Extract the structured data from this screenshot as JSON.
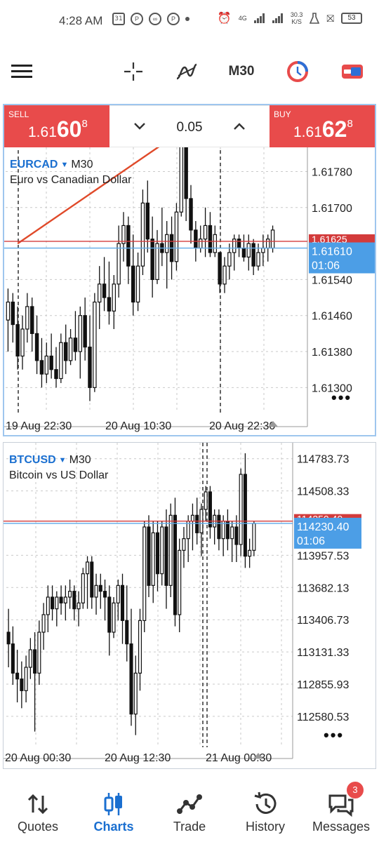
{
  "status_bar": {
    "time": "4:28 AM",
    "calendar": "31",
    "net_speed": "30.3",
    "net_unit": "K/S",
    "net_type": "4G",
    "battery": "53"
  },
  "toolbar": {
    "timeframe": "M30",
    "icons": [
      "menu-icon",
      "crosshair-icon",
      "indicators-icon",
      "timeframe",
      "one-click-trading-icon",
      "toggle-icon"
    ]
  },
  "trade_bar": {
    "sell_label": "SELL",
    "sell_price_prefix": "1.61",
    "sell_price_big": "60",
    "sell_price_sup": "8",
    "buy_label": "BUY",
    "buy_price_prefix": "1.61",
    "buy_price_big": "62",
    "buy_price_sup": "8",
    "lot": "0.05",
    "colors": {
      "trade_button": "#e84b4b"
    }
  },
  "eurcad_chart": {
    "symbol": "EURCAD",
    "timeframe": "M30",
    "description": "Euro vs Canadian Dollar",
    "more": "•••"
  },
  "btcusd_chart": {
    "symbol": "BTCUSD",
    "timeframe": "M30",
    "description": "Bitcoin vs US Dollar",
    "more": "•••"
  },
  "chart_data": [
    {
      "type": "candlestick",
      "symbol": "EURCAD",
      "timeframe": "M30",
      "y_ticks": [
        1.6178,
        1.617,
        1.6154,
        1.6146,
        1.6138,
        1.613
      ],
      "y_tick_labels": [
        "1.61780",
        "1.61700",
        "1.61540",
        "1.61460",
        "1.61380",
        "1.61300"
      ],
      "ylim": [
        1.6126,
        1.6184
      ],
      "x_tick_labels": [
        "19 Aug 22:30",
        "20 Aug 10:30",
        "20 Aug 22:30"
      ],
      "ask_price": 1.61625,
      "ask_label": "1.61625",
      "bid_price": 1.6161,
      "bid_label": "1.61610",
      "countdown": "01:06",
      "trendline": {
        "from": [
          2,
          1.6162
        ],
        "to": [
          32,
          1.6184
        ]
      },
      "colors": {
        "ask_line": "#d33b3b",
        "bid_line": "#5ea9e8",
        "trendline": "#e04a2a",
        "bid_tag": "#4c9ee6"
      },
      "candles": [
        {
          "o": 1.6145,
          "h": 1.6152,
          "l": 1.6138,
          "c": 1.6149
        },
        {
          "o": 1.6149,
          "h": 1.6151,
          "l": 1.614,
          "c": 1.6144
        },
        {
          "o": 1.6144,
          "h": 1.6148,
          "l": 1.6134,
          "c": 1.6137
        },
        {
          "o": 1.6137,
          "h": 1.6146,
          "l": 1.6134,
          "c": 1.6143
        },
        {
          "o": 1.6143,
          "h": 1.6151,
          "l": 1.614,
          "c": 1.6148
        },
        {
          "o": 1.6148,
          "h": 1.615,
          "l": 1.6138,
          "c": 1.6142
        },
        {
          "o": 1.6142,
          "h": 1.6146,
          "l": 1.6133,
          "c": 1.6136
        },
        {
          "o": 1.6136,
          "h": 1.6141,
          "l": 1.613,
          "c": 1.6133
        },
        {
          "o": 1.6133,
          "h": 1.614,
          "l": 1.6131,
          "c": 1.6137
        },
        {
          "o": 1.6137,
          "h": 1.6142,
          "l": 1.6132,
          "c": 1.6134
        },
        {
          "o": 1.6134,
          "h": 1.6139,
          "l": 1.613,
          "c": 1.6132
        },
        {
          "o": 1.6132,
          "h": 1.6142,
          "l": 1.6131,
          "c": 1.614
        },
        {
          "o": 1.614,
          "h": 1.6144,
          "l": 1.6133,
          "c": 1.6136
        },
        {
          "o": 1.6136,
          "h": 1.6143,
          "l": 1.6135,
          "c": 1.6141
        },
        {
          "o": 1.6141,
          "h": 1.6147,
          "l": 1.6136,
          "c": 1.6138
        },
        {
          "o": 1.6138,
          "h": 1.6148,
          "l": 1.6132,
          "c": 1.6146
        },
        {
          "o": 1.6146,
          "h": 1.615,
          "l": 1.6136,
          "c": 1.6139
        },
        {
          "o": 1.6139,
          "h": 1.6146,
          "l": 1.6127,
          "c": 1.613
        },
        {
          "o": 1.613,
          "h": 1.6151,
          "l": 1.6129,
          "c": 1.6149
        },
        {
          "o": 1.6149,
          "h": 1.6157,
          "l": 1.6143,
          "c": 1.6153
        },
        {
          "o": 1.6153,
          "h": 1.6159,
          "l": 1.6147,
          "c": 1.615
        },
        {
          "o": 1.615,
          "h": 1.6158,
          "l": 1.6144,
          "c": 1.6147
        },
        {
          "o": 1.6147,
          "h": 1.6155,
          "l": 1.6143,
          "c": 1.6153
        },
        {
          "o": 1.6153,
          "h": 1.6166,
          "l": 1.615,
          "c": 1.6162
        },
        {
          "o": 1.6162,
          "h": 1.6169,
          "l": 1.6158,
          "c": 1.6166
        },
        {
          "o": 1.6166,
          "h": 1.6168,
          "l": 1.6153,
          "c": 1.6157
        },
        {
          "o": 1.6157,
          "h": 1.6164,
          "l": 1.6146,
          "c": 1.6149
        },
        {
          "o": 1.6149,
          "h": 1.616,
          "l": 1.6147,
          "c": 1.6157
        },
        {
          "o": 1.6157,
          "h": 1.6174,
          "l": 1.6155,
          "c": 1.6171
        },
        {
          "o": 1.6171,
          "h": 1.6176,
          "l": 1.616,
          "c": 1.6163
        },
        {
          "o": 1.6163,
          "h": 1.6168,
          "l": 1.615,
          "c": 1.6154
        },
        {
          "o": 1.6154,
          "h": 1.6165,
          "l": 1.6153,
          "c": 1.6162
        },
        {
          "o": 1.6162,
          "h": 1.617,
          "l": 1.6157,
          "c": 1.616
        },
        {
          "o": 1.616,
          "h": 1.6167,
          "l": 1.6152,
          "c": 1.6164
        },
        {
          "o": 1.6164,
          "h": 1.6168,
          "l": 1.6154,
          "c": 1.6158
        },
        {
          "o": 1.6158,
          "h": 1.6171,
          "l": 1.6156,
          "c": 1.6169
        },
        {
          "o": 1.6169,
          "h": 1.6186,
          "l": 1.6168,
          "c": 1.6185
        },
        {
          "o": 1.6185,
          "h": 1.6186,
          "l": 1.6167,
          "c": 1.6172
        },
        {
          "o": 1.6172,
          "h": 1.6175,
          "l": 1.6162,
          "c": 1.6165
        },
        {
          "o": 1.6165,
          "h": 1.6167,
          "l": 1.6158,
          "c": 1.6161
        },
        {
          "o": 1.6161,
          "h": 1.6166,
          "l": 1.616,
          "c": 1.6163
        },
        {
          "o": 1.6163,
          "h": 1.617,
          "l": 1.6159,
          "c": 1.6166
        },
        {
          "o": 1.6166,
          "h": 1.6169,
          "l": 1.6159,
          "c": 1.616
        },
        {
          "o": 1.616,
          "h": 1.6166,
          "l": 1.6159,
          "c": 1.6164
        },
        {
          "o": 1.616,
          "h": 1.616,
          "l": 1.6151,
          "c": 1.6153
        },
        {
          "o": 1.6153,
          "h": 1.6159,
          "l": 1.6151,
          "c": 1.6157
        },
        {
          "o": 1.6157,
          "h": 1.6162,
          "l": 1.6154,
          "c": 1.616
        },
        {
          "o": 1.616,
          "h": 1.6164,
          "l": 1.6156,
          "c": 1.6163
        },
        {
          "o": 1.6163,
          "h": 1.6164,
          "l": 1.6159,
          "c": 1.6161
        },
        {
          "o": 1.6161,
          "h": 1.6164,
          "l": 1.6158,
          "c": 1.6159
        },
        {
          "o": 1.6159,
          "h": 1.6164,
          "l": 1.6156,
          "c": 1.6162
        },
        {
          "o": 1.6162,
          "h": 1.6163,
          "l": 1.6155,
          "c": 1.6157
        },
        {
          "o": 1.6157,
          "h": 1.6162,
          "l": 1.6156,
          "c": 1.616
        },
        {
          "o": 1.616,
          "h": 1.6164,
          "l": 1.6157,
          "c": 1.6161
        },
        {
          "o": 1.6161,
          "h": 1.6164,
          "l": 1.6158,
          "c": 1.6163
        },
        {
          "o": 1.6161,
          "h": 1.6166,
          "l": 1.616,
          "c": 1.6165
        }
      ]
    },
    {
      "type": "candlestick",
      "symbol": "BTCUSD",
      "timeframe": "M30",
      "y_ticks": [
        114783.73,
        114508.33,
        113957.53,
        113682.13,
        113406.73,
        113131.33,
        112855.93,
        112580.53
      ],
      "y_tick_labels": [
        "114783.73",
        "114508.33",
        "113957.53",
        "113682.13",
        "113406.73",
        "113131.33",
        "112855.93",
        "112580.53"
      ],
      "ylim": [
        112400,
        114860
      ],
      "x_tick_labels": [
        "20 Aug 00:30",
        "20 Aug 12:30",
        "21 Aug 00:30"
      ],
      "ask_price": 114250,
      "ask_label": "114250.40",
      "bid_price": 114230.4,
      "bid_label": "114230.40",
      "countdown": "01:06",
      "colors": {
        "ask_line": "#d33b3b",
        "bid_line": "#5ea9e8",
        "bid_tag": "#4c9ee6"
      },
      "candles": [
        {
          "o": 113300,
          "h": 113500,
          "l": 113000,
          "c": 113200
        },
        {
          "o": 113200,
          "h": 113350,
          "l": 112850,
          "c": 112950
        },
        {
          "o": 112950,
          "h": 113150,
          "l": 112700,
          "c": 112900
        },
        {
          "o": 112900,
          "h": 113050,
          "l": 112650,
          "c": 112800
        },
        {
          "o": 112800,
          "h": 113100,
          "l": 112700,
          "c": 113000
        },
        {
          "o": 113000,
          "h": 113250,
          "l": 112900,
          "c": 113150
        },
        {
          "o": 113150,
          "h": 113300,
          "l": 112450,
          "c": 112950
        },
        {
          "o": 112950,
          "h": 113400,
          "l": 112850,
          "c": 113300
        },
        {
          "o": 113300,
          "h": 113550,
          "l": 113150,
          "c": 113450
        },
        {
          "o": 113450,
          "h": 113700,
          "l": 113300,
          "c": 113600
        },
        {
          "o": 113600,
          "h": 113700,
          "l": 113400,
          "c": 113500
        },
        {
          "o": 113500,
          "h": 113650,
          "l": 113350,
          "c": 113600
        },
        {
          "o": 113600,
          "h": 113700,
          "l": 113450,
          "c": 113550
        },
        {
          "o": 113550,
          "h": 113700,
          "l": 113400,
          "c": 113600
        },
        {
          "o": 113600,
          "h": 113750,
          "l": 113500,
          "c": 113650
        },
        {
          "o": 113650,
          "h": 113700,
          "l": 113400,
          "c": 113500
        },
        {
          "o": 113500,
          "h": 113650,
          "l": 113350,
          "c": 113550
        },
        {
          "o": 113550,
          "h": 113850,
          "l": 113500,
          "c": 113800
        },
        {
          "o": 113800,
          "h": 113950,
          "l": 113500,
          "c": 113900
        },
        {
          "o": 113900,
          "h": 113950,
          "l": 113500,
          "c": 113600
        },
        {
          "o": 113600,
          "h": 113800,
          "l": 113450,
          "c": 113700
        },
        {
          "o": 113700,
          "h": 113800,
          "l": 113500,
          "c": 113650
        },
        {
          "o": 113650,
          "h": 113750,
          "l": 113400,
          "c": 113600
        },
        {
          "o": 113600,
          "h": 113700,
          "l": 113100,
          "c": 113300
        },
        {
          "o": 113300,
          "h": 113600,
          "l": 113250,
          "c": 113550
        },
        {
          "o": 113550,
          "h": 113750,
          "l": 113400,
          "c": 113700
        },
        {
          "o": 113700,
          "h": 113800,
          "l": 113200,
          "c": 113400
        },
        {
          "o": 113400,
          "h": 113700,
          "l": 113050,
          "c": 113200
        },
        {
          "o": 113200,
          "h": 113500,
          "l": 112500,
          "c": 112600
        },
        {
          "o": 112600,
          "h": 113100,
          "l": 112420,
          "c": 112950
        },
        {
          "o": 112950,
          "h": 113500,
          "l": 112800,
          "c": 113400
        },
        {
          "o": 113400,
          "h": 114250,
          "l": 113300,
          "c": 114200
        },
        {
          "o": 114200,
          "h": 114300,
          "l": 113600,
          "c": 113700
        },
        {
          "o": 113700,
          "h": 114250,
          "l": 113550,
          "c": 114150
        },
        {
          "o": 114150,
          "h": 114250,
          "l": 113650,
          "c": 113800
        },
        {
          "o": 113800,
          "h": 114250,
          "l": 113700,
          "c": 114200
        },
        {
          "o": 114200,
          "h": 114350,
          "l": 113500,
          "c": 113700
        },
        {
          "o": 113700,
          "h": 114400,
          "l": 113600,
          "c": 114300
        },
        {
          "o": 114300,
          "h": 114450,
          "l": 113350,
          "c": 113450
        },
        {
          "o": 113450,
          "h": 114100,
          "l": 113300,
          "c": 114000
        },
        {
          "o": 114000,
          "h": 114200,
          "l": 113850,
          "c": 114100
        },
        {
          "o": 114100,
          "h": 114300,
          "l": 113900,
          "c": 114250
        },
        {
          "o": 114250,
          "h": 114400,
          "l": 114000,
          "c": 114300
        },
        {
          "o": 114300,
          "h": 114450,
          "l": 114050,
          "c": 114150
        },
        {
          "o": 114150,
          "h": 114400,
          "l": 113950,
          "c": 114350
        },
        {
          "o": 114350,
          "h": 114550,
          "l": 114250,
          "c": 114500
        },
        {
          "o": 114500,
          "h": 114550,
          "l": 114100,
          "c": 114200
        },
        {
          "o": 114200,
          "h": 114350,
          "l": 114050,
          "c": 114300
        },
        {
          "o": 114300,
          "h": 114350,
          "l": 114000,
          "c": 114100
        },
        {
          "o": 114100,
          "h": 114300,
          "l": 113950,
          "c": 114250
        },
        {
          "o": 114250,
          "h": 114350,
          "l": 114000,
          "c": 114100
        },
        {
          "o": 114100,
          "h": 114250,
          "l": 113900,
          "c": 114200
        },
        {
          "o": 114200,
          "h": 114300,
          "l": 113900,
          "c": 114050
        },
        {
          "o": 114050,
          "h": 114700,
          "l": 113950,
          "c": 114650
        },
        {
          "o": 114650,
          "h": 114830,
          "l": 113850,
          "c": 113950
        },
        {
          "o": 113950,
          "h": 114100,
          "l": 113850,
          "c": 114000
        },
        {
          "o": 114000,
          "h": 114250,
          "l": 113950,
          "c": 114230
        }
      ]
    }
  ],
  "bottom_nav": {
    "items": [
      {
        "label": "Quotes",
        "icon": "quotes-icon"
      },
      {
        "label": "Charts",
        "icon": "charts-icon"
      },
      {
        "label": "Trade",
        "icon": "trade-icon"
      },
      {
        "label": "History",
        "icon": "history-icon"
      },
      {
        "label": "Messages",
        "icon": "messages-icon"
      }
    ],
    "active": "Charts",
    "messages_badge": "3",
    "colors": {
      "active": "#1a6fd0",
      "badge": "#e84b4b"
    }
  }
}
